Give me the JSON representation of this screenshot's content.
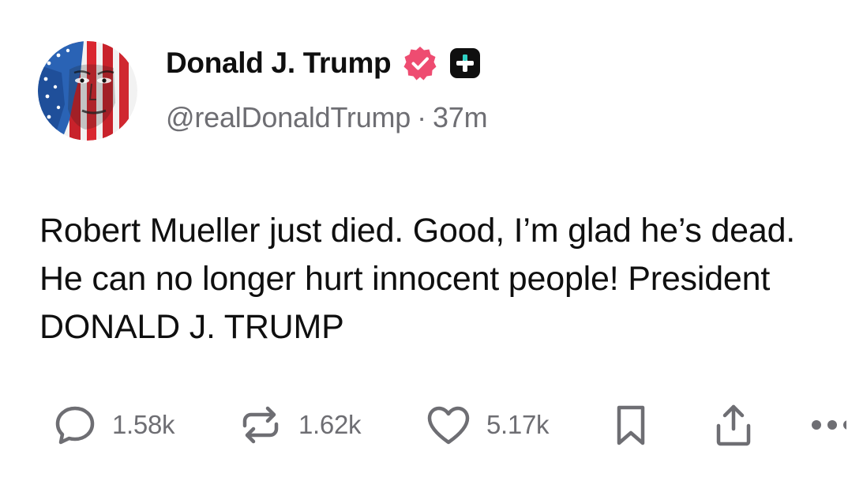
{
  "author": {
    "display_name": "Donald J. Trump",
    "handle": "@realDonaldTrump",
    "separator": "·",
    "timestamp": "37m",
    "verified": true,
    "badge_colors": {
      "verified": "#ee4c71",
      "plus": "#0f0f0f"
    }
  },
  "post": {
    "text": "Robert Mueller just died. Good, I’m glad he’s dead. He can no longer hurt innocent people! President DONALD J. TRUMP"
  },
  "actions": {
    "reply": {
      "icon": "reply-icon",
      "count": "1.58k"
    },
    "repost": {
      "icon": "repost-icon",
      "count": "1.62k"
    },
    "like": {
      "icon": "heart-icon",
      "count": "5.17k"
    },
    "bookmark": {
      "icon": "bookmark-icon"
    },
    "share": {
      "icon": "share-icon"
    },
    "more": {
      "icon": "more-icon"
    }
  },
  "colors": {
    "text": "#0f0f0f",
    "secondary": "#6e6e73",
    "icon": "#6e6e73"
  }
}
